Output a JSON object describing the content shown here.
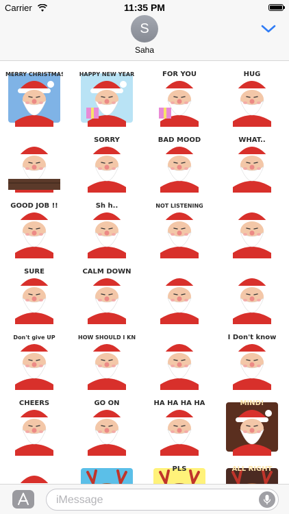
{
  "status_bar": {
    "carrier": "Carrier",
    "time": "11:35 PM",
    "wifi_icon": "wifi-icon",
    "battery_icon": "battery-icon"
  },
  "header": {
    "avatar_initial": "S",
    "contact_name": "Saha",
    "chevron_icon": "chevron-down-icon",
    "accent_color": "#2f7cf6"
  },
  "stickers": [
    {
      "label": "MERRY CHRISTMAS!",
      "theme": "santa-sleigh"
    },
    {
      "label": "HAPPY NEW YEAR",
      "theme": "santa-gifts"
    },
    {
      "label": "FOR YOU",
      "theme": "santa-gift"
    },
    {
      "label": "HUG",
      "theme": "santa-reindeer-hug"
    },
    {
      "label": "",
      "theme": "santa-chimney"
    },
    {
      "label": "SORRY",
      "theme": "santa-sorry"
    },
    {
      "label": "BAD MOOD",
      "theme": "santa-bad-mood"
    },
    {
      "label": "WHAT..",
      "theme": "santa-question"
    },
    {
      "label": "GOOD JOB !!",
      "theme": "santa-good-job"
    },
    {
      "label": "Sh h..",
      "theme": "santa-shh"
    },
    {
      "label": "NOT LISTENING",
      "theme": "santa-not-listening"
    },
    {
      "label": "",
      "theme": "santa-blah"
    },
    {
      "label": "SURE",
      "theme": "santa-sure"
    },
    {
      "label": "CALM DOWN",
      "theme": "santa-calm-down"
    },
    {
      "label": "",
      "theme": "santa-thinking"
    },
    {
      "label": "",
      "theme": "santa-surprised"
    },
    {
      "label": "Don't give UP",
      "theme": "santa-dont-give-up"
    },
    {
      "label": "HOW SHOULD I KNOW?",
      "theme": "santa-how-should-i-know"
    },
    {
      "label": "",
      "theme": "santa-fist"
    },
    {
      "label": "I Don't know",
      "theme": "santa-shrug"
    },
    {
      "label": "CHEERS",
      "theme": "santa-cheers"
    },
    {
      "label": "GO ON",
      "theme": "santa-go-on"
    },
    {
      "label": "HA HA HA HA",
      "theme": "santa-laughing"
    },
    {
      "label": "MIND!",
      "theme": "santa-mind"
    },
    {
      "label": "",
      "theme": "santa-partial"
    },
    {
      "label": "",
      "theme": "reindeer-snow"
    },
    {
      "label": "PLS",
      "theme": "reindeer-pls"
    },
    {
      "label": "ALL RIGHT",
      "theme": "reindeer-all-right"
    }
  ],
  "input_bar": {
    "apps_icon": "app-store-icon",
    "placeholder": "iMessage",
    "mic_icon": "microphone-icon"
  }
}
